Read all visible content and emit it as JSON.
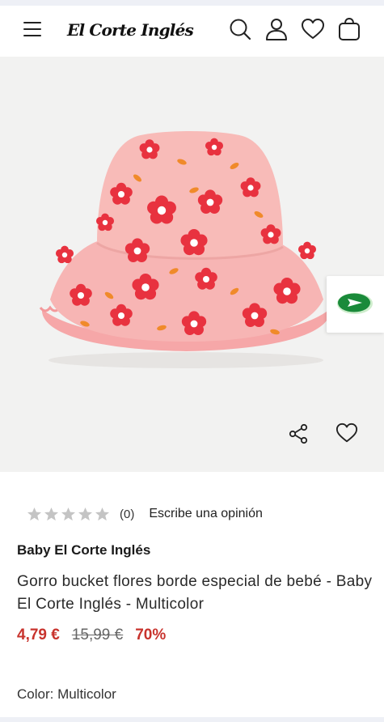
{
  "header": {
    "logo_text": "El Corte Inglés",
    "icons": [
      "menu-icon",
      "search-icon",
      "user-icon",
      "heart-icon",
      "bag-icon"
    ]
  },
  "gallery": {
    "image_subject": "pink bucket hat with red flowers",
    "float_icon": "send-arrow-icon",
    "actions": [
      "share-icon",
      "heart-icon"
    ],
    "progress_fraction": 0.5
  },
  "product": {
    "rating": {
      "stars_filled": 0,
      "stars_total": 5,
      "count_text": "(0)",
      "write_review": "Escribe una opinión"
    },
    "brand": "Baby El Corte Inglés",
    "title": "Gorro bucket flores borde especial de bebé - Baby El Corte Inglés - Multicolor",
    "price": {
      "current": "4,79 €",
      "original": "15,99 €",
      "discount": "70%"
    },
    "color_line": "Color: Multicolor"
  },
  "colors": {
    "price_red": "#c8332d",
    "accent_green": "#1a8a3a",
    "star_grey": "#c4c4c4",
    "hat_pink": "#f6b3b3",
    "flower_red": "#e8323f"
  }
}
